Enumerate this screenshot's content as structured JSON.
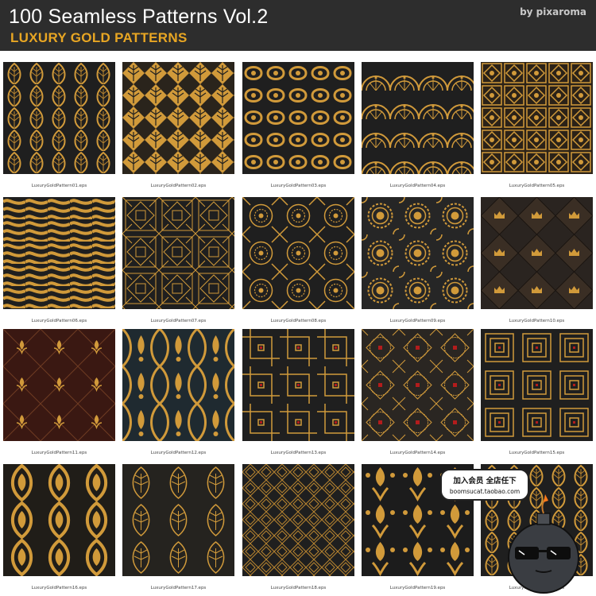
{
  "header": {
    "title": "100 Seamless Patterns Vol.2",
    "subtitle": "LUXURY GOLD PATTERNS",
    "byline": "by pixaroma"
  },
  "colors": {
    "header_bg": "#2d2d2d",
    "subtitle_gold": "#e8a623",
    "gold": "#d19a3a",
    "dark": "#1f1f1f"
  },
  "tiles": [
    {
      "caption": "LuxuryGoldPattern01.eps",
      "motif": "leaf-arch"
    },
    {
      "caption": "LuxuryGoldPattern02.eps",
      "motif": "palmette-diamond"
    },
    {
      "caption": "LuxuryGoldPattern03.eps",
      "motif": "damask-scroll"
    },
    {
      "caption": "LuxuryGoldPattern04.eps",
      "motif": "art-deco-fan"
    },
    {
      "caption": "LuxuryGoldPattern05.eps",
      "motif": "ornate-lattice"
    },
    {
      "caption": "LuxuryGoldPattern06.eps",
      "motif": "wave-stripe"
    },
    {
      "caption": "LuxuryGoldPattern07.eps",
      "motif": "geometric-deco"
    },
    {
      "caption": "LuxuryGoldPattern08.eps",
      "motif": "mandala-grid"
    },
    {
      "caption": "LuxuryGoldPattern09.eps",
      "motif": "mandala-polka"
    },
    {
      "caption": "LuxuryGoldPattern10.eps",
      "motif": "quilted-crown"
    },
    {
      "caption": "LuxuryGoldPattern11.eps",
      "motif": "fleur-diamond"
    },
    {
      "caption": "LuxuryGoldPattern12.eps",
      "motif": "ogee-fleur"
    },
    {
      "caption": "LuxuryGoldPattern13.eps",
      "motif": "deco-maze"
    },
    {
      "caption": "LuxuryGoldPattern14.eps",
      "motif": "ornate-tile"
    },
    {
      "caption": "LuxuryGoldPattern15.eps",
      "motif": "deco-square"
    },
    {
      "caption": "LuxuryGoldPattern16.eps",
      "motif": "damask-ogee"
    },
    {
      "caption": "LuxuryGoldPattern17.eps",
      "motif": "filigree"
    },
    {
      "caption": "LuxuryGoldPattern18.eps",
      "motif": "line-diamond"
    },
    {
      "caption": "LuxuryGoldPattern19.eps",
      "motif": "damask-flower"
    },
    {
      "caption": "LuxuryGoldPattern20.eps",
      "motif": "leaf-arch"
    }
  ],
  "watermark": {
    "line1": "加入会员 全店任下",
    "line2": "boomsucat.taobao.com",
    "mascot": "bomb-mascot-icon"
  }
}
